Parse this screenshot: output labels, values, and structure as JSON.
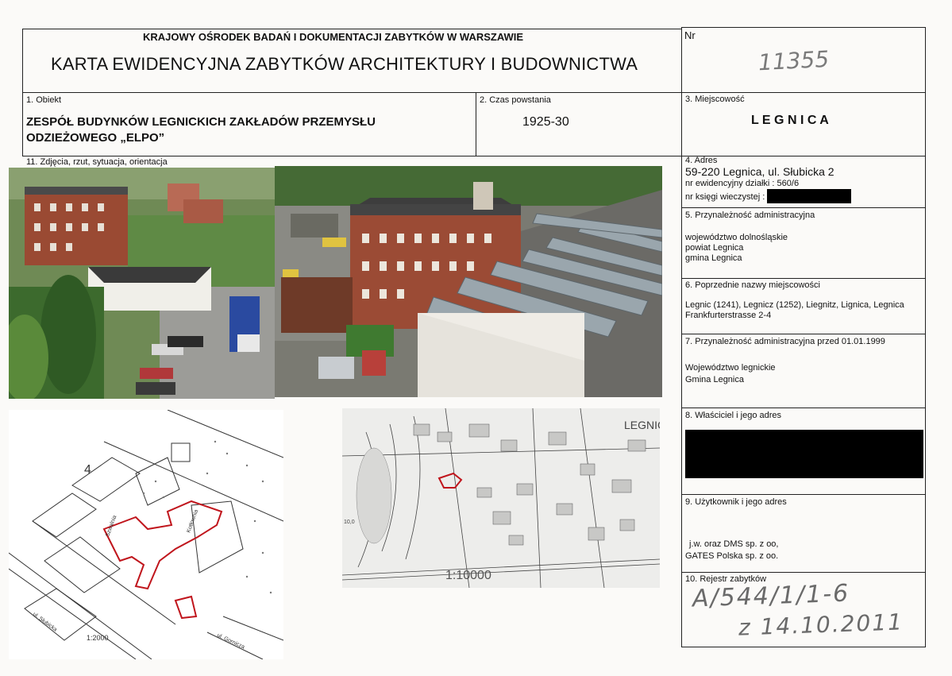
{
  "header": {
    "institution": "KRAJOWY OŚRODEK BADAŃ I DOKUMENTACJI ZABYTKÓW W WARSZAWIE",
    "title": "KARTA EWIDENCYJNA ZABYTKÓW ARCHITEKTURY I BUDOWNICTWA",
    "nr_label": "Nr",
    "nr_value": "11355"
  },
  "obiekt": {
    "label": "1. Obiekt",
    "line1": "ZESPÓŁ BUDYNKÓW LEGNICKICH ZAKŁADÓW PRZEMYSŁU",
    "line2": "ODZIEŻOWEGO „ELPO”"
  },
  "czas": {
    "label": "2. Czas powstania",
    "value": "1925-30"
  },
  "miejscowosc": {
    "label": "3. Miejscowość",
    "value": "L E G N I C A"
  },
  "zdjecia": {
    "label": "11. Zdjęcia, rzut, sytuacja, orientacja"
  },
  "adres": {
    "label": "4. Adres",
    "street": "59-220 Legnica, ul. Słubicka 2",
    "parcel": "nr ewidencyjny działki : 560/6",
    "kw_label": "nr księgi wieczystej :"
  },
  "przynaleznosc": {
    "label": "5. Przynależność administracyjna",
    "line1": "województwo dolnośląskie",
    "line2": "powiat Legnica",
    "line3": "gmina Legnica"
  },
  "poprzednie": {
    "label": "6. Poprzednie nazwy miejscowości",
    "line1": "Legnic (1241), Legnicz (1252), Liegnitz, Lignica, Legnica",
    "line2": "Frankfurterstrasse 2-4"
  },
  "przed1999": {
    "label": "7. Przynależność administracyjna przed  01.01.1999",
    "line1": "Województwo legnickie",
    "line2": "Gmina Legnica"
  },
  "wlasciciel": {
    "label": "8. Właściciel i jego adres"
  },
  "uzytkownik": {
    "label": "9. Użytkownik i jego adres",
    "line1": "j.w. oraz DMS sp. z oo,",
    "line2": "GATES Polska sp. z oo."
  },
  "rejestr": {
    "label": "10. Rejestr zabytków",
    "hand1": "A/544/1/1-6",
    "hand2": "z 14.10.2011"
  },
  "plan_left": {
    "scale": "1:2000",
    "north": "4",
    "street1": "ul. Słubicka",
    "street2": "ul. Gornicza",
    "bld1": "Szwalnia",
    "bld2": "Kotłownia"
  },
  "plan_right": {
    "scale": "1:10000",
    "town": "LEGNIC",
    "elev": "10,0"
  },
  "colors": {
    "red_outline": "#c0151c",
    "grid": "#222222"
  }
}
